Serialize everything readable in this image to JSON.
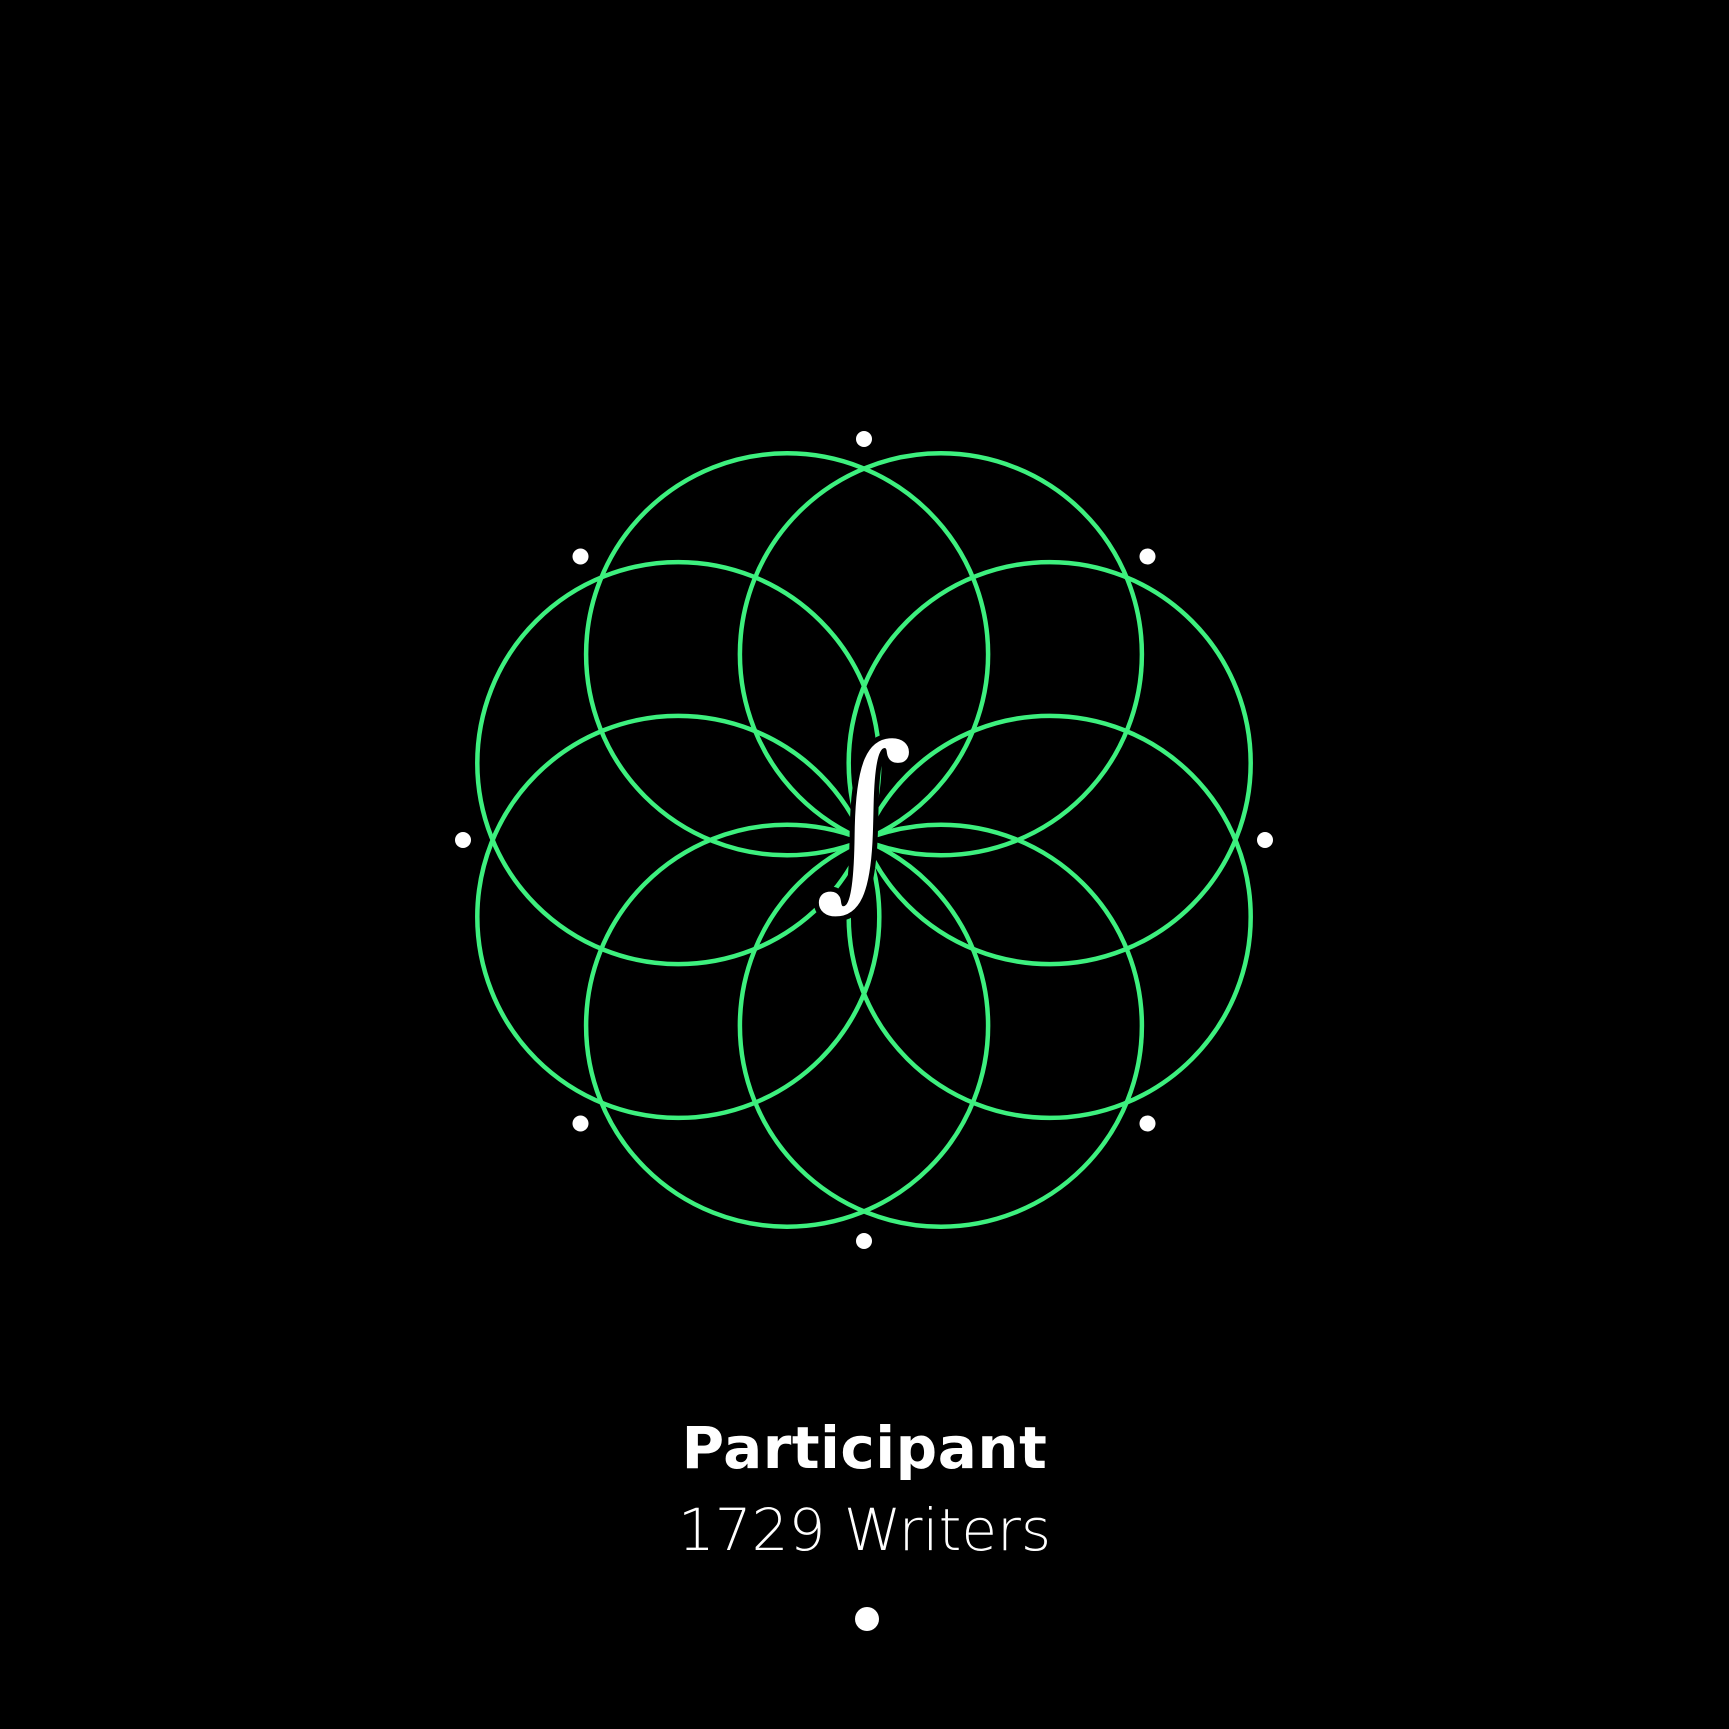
{
  "badge": {
    "symbol": "∫",
    "title": "Participant",
    "subtitle": "1729 Writers",
    "colors": {
      "background": "#000000",
      "ring": "#3df07e",
      "accent": "#ffffff"
    },
    "icon": "integral-flower-icon"
  }
}
